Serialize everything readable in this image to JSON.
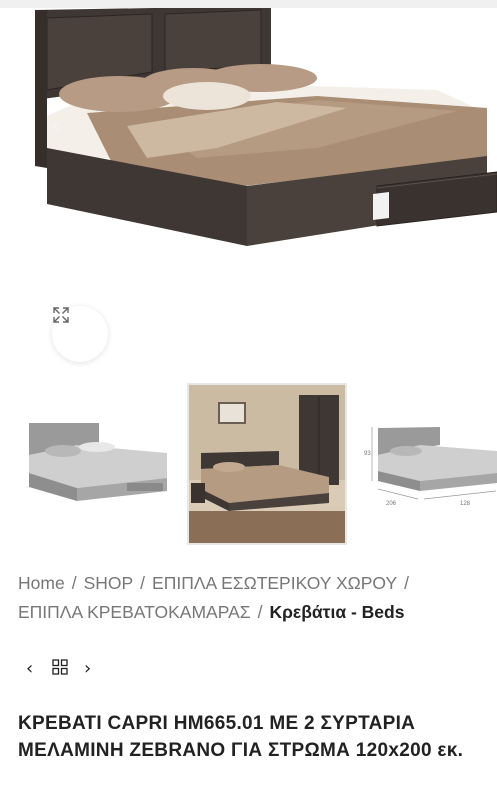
{
  "gallery": {
    "main_image_alt": "Κρεβάτι Capri ΗΜ665.01",
    "prev_icon": "chevron-left-icon",
    "next_icon": "chevron-right-icon",
    "zoom_icon": "expand-icon",
    "prev_glyph": "‹",
    "next_glyph": "›"
  },
  "thumbnails": [
    {
      "alt": "Κρεβάτι γκρι"
    },
    {
      "alt": "Κρεβάτι σε δωμάτιο"
    },
    {
      "alt": "Κρεβάτι διαστάσεις"
    }
  ],
  "thumb_dimensions": [
    "93",
    "206",
    "128"
  ],
  "breadcrumb": {
    "items": [
      "Home",
      "SHOP",
      "ΕΠΙΠΛΑ ΕΣΩΤΕΡΙΚΟΥ ΧΩΡΟΥ",
      "ΕΠΙΠΛΑ ΚΡΕΒΑΤΟΚΑΜΑΡΑΣ"
    ],
    "separator": "/",
    "current": "Κρεβάτια - Beds"
  },
  "product_nav": {
    "prev_glyph": "‹",
    "next_glyph": "›",
    "prev_icon": "chevron-left-icon",
    "grid_icon": "grid-icon",
    "next_icon": "chevron-right-icon"
  },
  "product": {
    "title": "ΚΡΕΒΑΤΙ CAPRI HM665.01 ΜΕ 2 ΣΥΡΤΑΡΙΑ ΜΕΛΑΜΙΝΗ ZEBRANO ΓΙΑ ΣΤΡΩΜΑ 120x200 εκ."
  },
  "colors": {
    "wood": "#3f3733",
    "sheet": "#a98d74",
    "breadcrumb_text": "#777777",
    "title_text": "#222222"
  }
}
